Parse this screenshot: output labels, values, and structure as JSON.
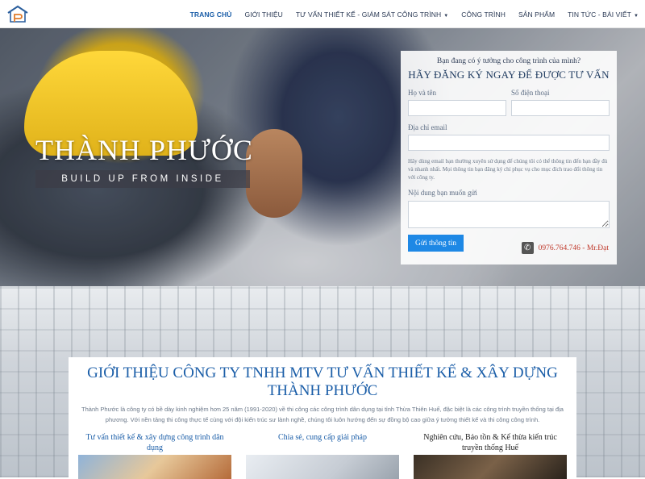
{
  "nav": {
    "logo_icon": "house-logo-icon",
    "items": [
      {
        "label": "TRANG CHỦ",
        "active": true,
        "dropdown": false
      },
      {
        "label": "GIỚI THIỆU",
        "active": false,
        "dropdown": false
      },
      {
        "label": "TƯ VẤN THIẾT KẾ - GIÁM SÁT CÔNG TRÌNH",
        "active": false,
        "dropdown": true
      },
      {
        "label": "CÔNG TRÌNH",
        "active": false,
        "dropdown": false
      },
      {
        "label": "SẢN PHẨM",
        "active": false,
        "dropdown": false
      },
      {
        "label": "TIN TỨC - BÀI VIẾT",
        "active": false,
        "dropdown": true
      }
    ]
  },
  "hero": {
    "brand_title": "THÀNH PHƯỚC",
    "brand_subtitle": "BUILD UP FROM INSIDE"
  },
  "form": {
    "question": "Bạn đang có ý tưởng cho công trình của mình?",
    "heading": "HÃY ĐĂNG KÝ NGAY ĐỂ ĐƯỢC TƯ VẤN",
    "name_label": "Họ và tên",
    "phone_label": "Số điện thoại",
    "email_label": "Địa chỉ email",
    "note": "Hãy dùng email bạn thường xuyên sử dụng để chúng tôi có thể thông tin đến bạn đầy đủ và nhanh nhất. Mọi thông tin bạn đăng ký chỉ phục vụ cho mục đích trao đổi thông tin với công ty.",
    "message_label": "Nội dung bạn muốn gửi",
    "submit_label": "Gửi thông tin",
    "phone_icon": "phone-icon",
    "hotline": "0976.764.746 - Mr.Đạt"
  },
  "intro": {
    "title": "GIỚI THIỆU CÔNG TY TNHH MTV TƯ VẤN THIẾT KẾ & XÂY DỰNG THÀNH PHƯỚC",
    "text": "Thành Phước là công ty có bề dày kinh nghiệm hơn 25 năm (1991-2020) về thi công các công trình dân dụng tại tỉnh Thừa Thiên Huế, đặc biệt là các công trình truyền thống tại địa phương. Với nền tảng thi công thực tế cùng với đội kiến trúc sư lành nghề, chúng tôi luôn hướng đến sự đồng bộ cao giữa ý tưởng thiết kế và thi công công trình.",
    "cards": [
      {
        "title": "Tư vấn thiết kế & xây dựng công trình dân dụng"
      },
      {
        "title": "Chia sẻ, cung cấp giải pháp"
      },
      {
        "title": "Nghiên cứu, Bảo tồn & Kế thừa kiến trúc truyền thống Huế"
      }
    ]
  }
}
